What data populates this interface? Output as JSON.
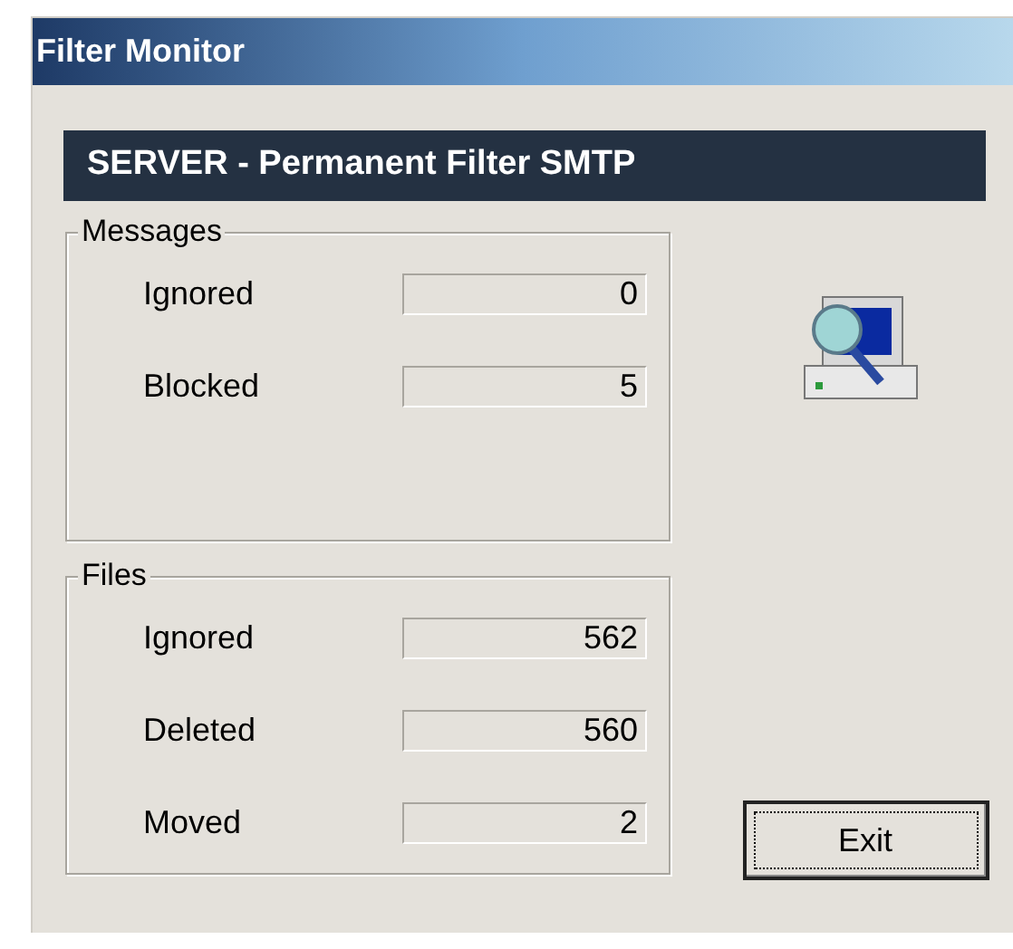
{
  "window": {
    "title": "Filter Monitor"
  },
  "header": "SERVER - Permanent Filter SMTP",
  "groups": [
    {
      "title": "Messages",
      "rows": [
        {
          "label": "Ignored",
          "value": "0"
        },
        {
          "label": "Blocked",
          "value": "5"
        }
      ]
    },
    {
      "title": "Files",
      "rows": [
        {
          "label": "Ignored",
          "value": "562"
        },
        {
          "label": "Deleted",
          "value": "560"
        },
        {
          "label": "Moved",
          "value": "2"
        }
      ]
    }
  ],
  "buttons": [
    {
      "label": "Exit",
      "focused": true
    }
  ]
}
